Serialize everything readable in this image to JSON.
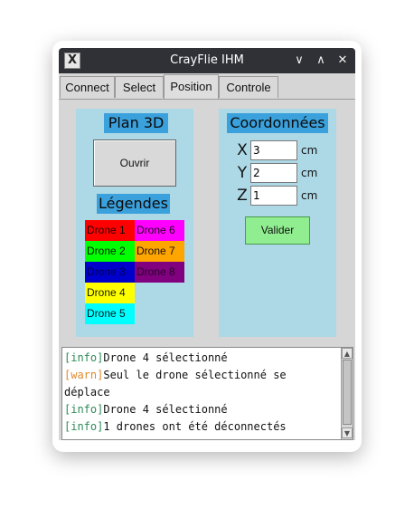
{
  "window": {
    "title": "CrayFlie IHM",
    "controls": [
      "∨",
      "∧",
      "✕"
    ],
    "app_icon": "X"
  },
  "tabs": [
    {
      "label": "Connect",
      "active": false
    },
    {
      "label": "Select",
      "active": false
    },
    {
      "label": "Position",
      "active": true
    },
    {
      "label": "Controle",
      "active": false
    }
  ],
  "plan3d": {
    "heading": "Plan 3D",
    "open_button": "Ouvrir",
    "legend_heading": "Légendes",
    "legend": [
      {
        "label": "Drone 1",
        "bg": "#ff0000",
        "fg": "#1a0000"
      },
      {
        "label": "Drone 6",
        "bg": "#ff00ff",
        "fg": "#1a001a"
      },
      {
        "label": "Drone 2",
        "bg": "#00ff00",
        "fg": "#001a00"
      },
      {
        "label": "Drone 7",
        "bg": "#ffa500",
        "fg": "#1a1000"
      },
      {
        "label": "Drone 3",
        "bg": "#0000cd",
        "fg": "#00004a"
      },
      {
        "label": "Drone 8",
        "bg": "#800080",
        "fg": "#2a002a"
      },
      {
        "label": "Drone 4",
        "bg": "#ffff00",
        "fg": "#1a1a00"
      },
      {
        "label": "Drone 5",
        "bg": "#00ffff",
        "fg": "#001a1a"
      }
    ]
  },
  "coords": {
    "heading": "Coordonnées",
    "rows": [
      {
        "axis": "X",
        "value": "3",
        "unit": "cm"
      },
      {
        "axis": "Y",
        "value": "2",
        "unit": "cm"
      },
      {
        "axis": "Z",
        "value": "1",
        "unit": "cm"
      }
    ],
    "validate_button": "Valider"
  },
  "log": [
    {
      "level": "info",
      "text": "Drone 4 sélectionné"
    },
    {
      "level": "warn",
      "text": "Seul le drone sélectionné se"
    },
    {
      "level": "",
      "text": "déplace"
    },
    {
      "level": "info",
      "text": "Drone 4 sélectionné"
    },
    {
      "level": "info",
      "text": "1 drones ont été déconnectés"
    }
  ],
  "scrollbar": {
    "up": "▲",
    "down": "▼"
  }
}
